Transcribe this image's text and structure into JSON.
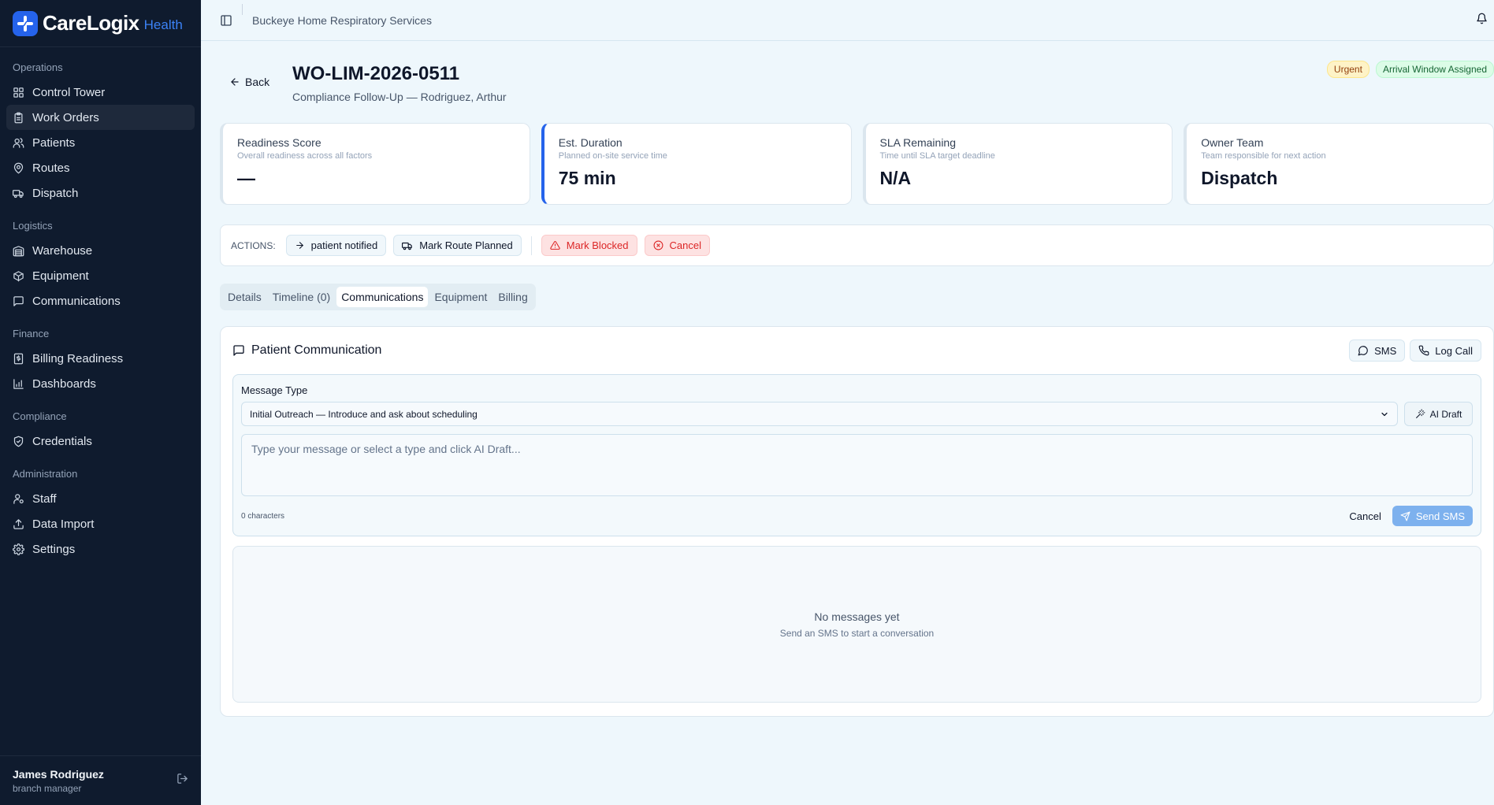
{
  "brand": {
    "name": "CareLogix",
    "sub": "Health"
  },
  "sidebar": {
    "sections": [
      {
        "title": "Operations",
        "items": [
          {
            "label": "Control Tower",
            "icon": "grid-icon"
          },
          {
            "label": "Work Orders",
            "icon": "clipboard-icon",
            "active": true
          },
          {
            "label": "Patients",
            "icon": "users-icon"
          },
          {
            "label": "Routes",
            "icon": "map-pin-icon"
          },
          {
            "label": "Dispatch",
            "icon": "truck-icon"
          }
        ]
      },
      {
        "title": "Logistics",
        "items": [
          {
            "label": "Warehouse",
            "icon": "warehouse-icon"
          },
          {
            "label": "Equipment",
            "icon": "package-icon"
          },
          {
            "label": "Communications",
            "icon": "message-square-icon"
          }
        ]
      },
      {
        "title": "Finance",
        "items": [
          {
            "label": "Billing Readiness",
            "icon": "receipt-icon"
          },
          {
            "label": "Dashboards",
            "icon": "bar-chart-icon"
          }
        ]
      },
      {
        "title": "Compliance",
        "items": [
          {
            "label": "Credentials",
            "icon": "shield-check-icon"
          }
        ]
      },
      {
        "title": "Administration",
        "items": [
          {
            "label": "Staff",
            "icon": "user-cog-icon"
          },
          {
            "label": "Data Import",
            "icon": "upload-icon"
          },
          {
            "label": "Settings",
            "icon": "settings-icon"
          }
        ]
      }
    ]
  },
  "user": {
    "name": "James Rodriguez",
    "role": "branch manager"
  },
  "topbar": {
    "org": "Buckeye Home Respiratory Services"
  },
  "header": {
    "back_label": "Back",
    "title": "WO-LIM-2026-0511",
    "subtitle": "Compliance Follow-Up — Rodriguez, Arthur",
    "badges": {
      "urgent": "Urgent",
      "arrival": "Arrival Window Assigned"
    }
  },
  "cards": {
    "readiness": {
      "title": "Readiness Score",
      "desc": "Overall readiness across all factors",
      "value": "—"
    },
    "duration": {
      "title": "Est. Duration",
      "desc": "Planned on-site service time",
      "value": "75 min"
    },
    "sla": {
      "title": "SLA Remaining",
      "desc": "Time until SLA target deadline",
      "value": "N/A"
    },
    "owner": {
      "title": "Owner Team",
      "desc": "Team responsible for next action",
      "value": "Dispatch"
    }
  },
  "actions": {
    "label": "ACTIONS:",
    "patient_notified": "patient notified",
    "mark_route_planned": "Mark Route Planned",
    "mark_blocked": "Mark Blocked",
    "cancel": "Cancel"
  },
  "tabs": {
    "details": "Details",
    "timeline": "Timeline (0)",
    "communications": "Communications",
    "equipment": "Equipment",
    "billing": "Billing",
    "active": "communications"
  },
  "comm": {
    "title": "Patient Communication",
    "sms_button": "SMS",
    "log_call_button": "Log Call",
    "message_type_label": "Message Type",
    "message_type_value": "Initial Outreach — Introduce and ask about scheduling",
    "ai_draft": "AI Draft",
    "placeholder": "Type your message or select a type and click AI Draft...",
    "char_count": "0 characters",
    "cancel": "Cancel",
    "send": "Send SMS",
    "empty_title": "No messages yet",
    "empty_sub": "Send an SMS to start a conversation"
  }
}
